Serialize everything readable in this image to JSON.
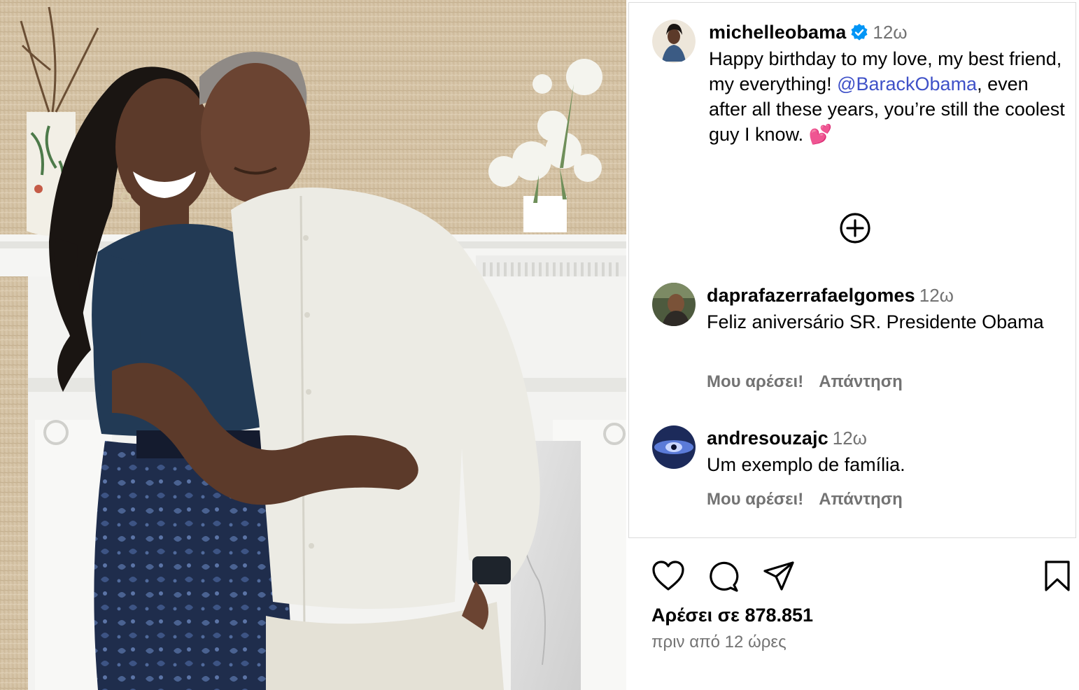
{
  "post": {
    "author": {
      "username": "michelleobama",
      "verified": true,
      "time": "12ω"
    },
    "caption": {
      "line_text_1": "Happy birthday to my love, my best friend, my everything!",
      "mention": "@BarackObama",
      "line_text_2": ", even after all these years, you’re still the coolest guy I know. 💕"
    },
    "load_more_icon": "plus-circle-icon",
    "comments": [
      {
        "username": "daprafazerrafaelgomes",
        "time": "12ω",
        "text": "Feliz aniversário SR. Presidente Obama",
        "like_label": "Μου αρέσει!",
        "reply_label": "Απάντηση"
      },
      {
        "username": "andresouzajc",
        "time": "12ω",
        "text": "Um exemplo de família.",
        "like_label": "Μου αρέσει!",
        "reply_label": "Απάντηση"
      }
    ],
    "actions": {
      "icons": [
        "heart-icon",
        "comment-icon",
        "share-icon",
        "bookmark-icon"
      ]
    },
    "likes_text": "Αρέσει σε 878.851",
    "posted_ago": "πριν από 12 ώρες"
  },
  "colors": {
    "mention": "#3f51c8",
    "verified": "#0095f6",
    "muted_text": "#737373",
    "border": "#dbdbdb"
  }
}
